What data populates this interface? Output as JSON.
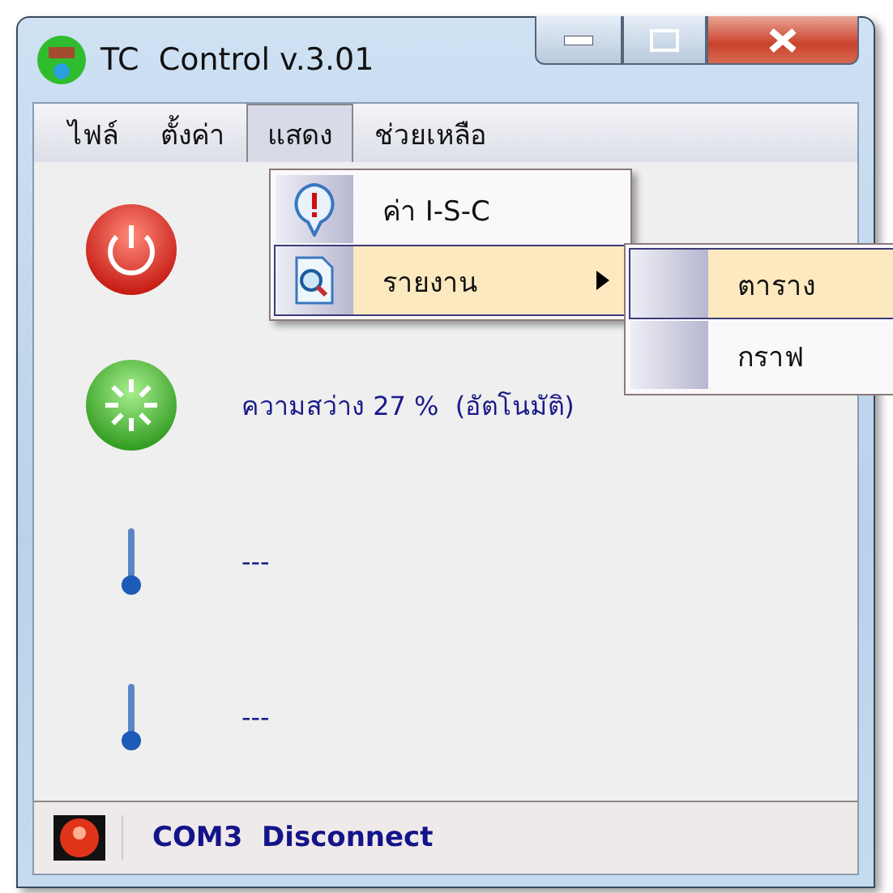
{
  "window": {
    "title": "TC  Control v.3.01"
  },
  "menu_bar": [
    {
      "label": "ไฟล์",
      "selected": false
    },
    {
      "label": "ตั้งค่า",
      "selected": false
    },
    {
      "label": "แสดง",
      "selected": true
    },
    {
      "label": "ช่วยเหลือ",
      "selected": false
    }
  ],
  "dropdown": [
    {
      "label": "ค่า I-S-C",
      "kind": "info",
      "selected": false,
      "has_submenu": false
    },
    {
      "label": "รายงาน",
      "kind": "report",
      "selected": true,
      "has_submenu": true
    }
  ],
  "submenu": [
    {
      "label": "ตาราง",
      "selected": true
    },
    {
      "label": "กราฟ",
      "selected": false
    }
  ],
  "rows": [
    {
      "kind": "power"
    },
    {
      "kind": "light",
      "text": "ความสว่าง 27 %  (อัตโนมัติ)"
    },
    {
      "kind": "thermometer",
      "text": "---"
    },
    {
      "kind": "thermometer",
      "text": "---"
    }
  ],
  "status_bar": {
    "connected": false,
    "text": "COM3  Disconnect"
  }
}
